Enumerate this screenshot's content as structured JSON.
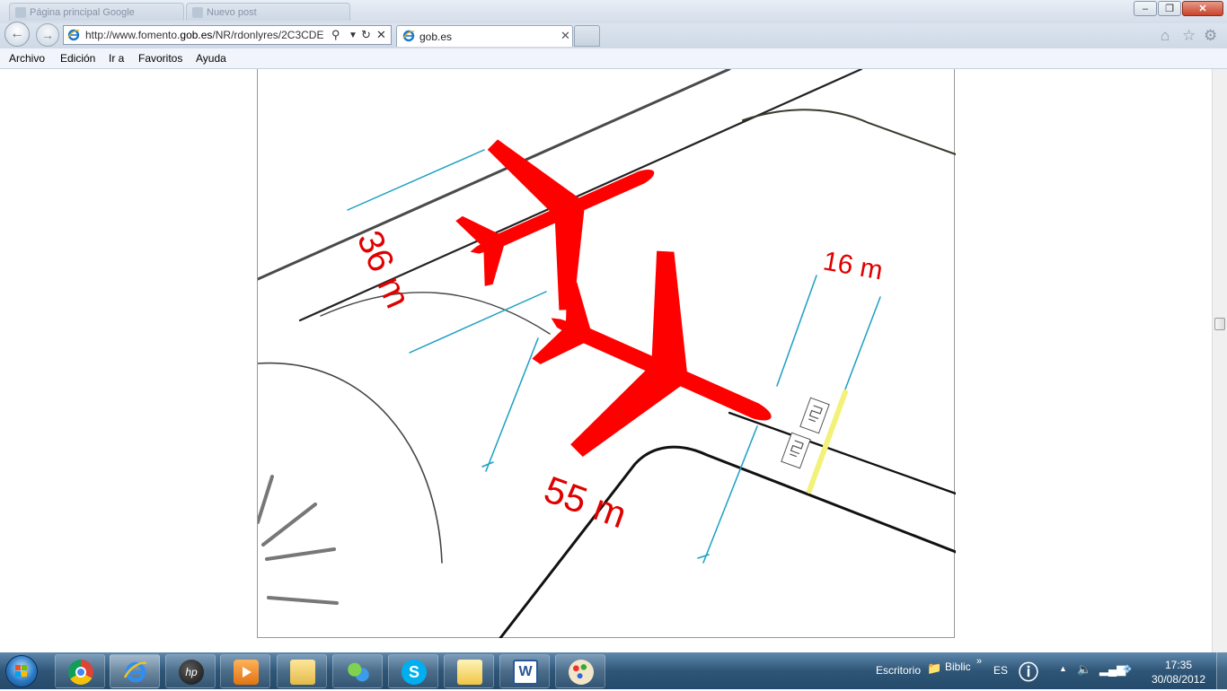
{
  "browser": {
    "url_prefix": "http://www.fomento.",
    "url_domain": "gob.es",
    "url_suffix": "/NR/rdonlyres/2C3CDE",
    "active_tab_title": "gob.es",
    "background_tabs": [
      "Página principal Google",
      "Nuevo post"
    ],
    "window_buttons": [
      "minimize-icon",
      "restore-icon",
      "close-icon"
    ]
  },
  "menu": {
    "items": [
      "Archivo",
      "Edición",
      "Ir a",
      "Favoritos",
      "Ayuda"
    ]
  },
  "diagram": {
    "label_36": "36 m",
    "label_55": "55 m",
    "label_16": "16 m",
    "aircraft_color": "#ff0000",
    "dimension_line_color": "#1a9fc4",
    "hold_line_color": "#f2f27a"
  },
  "taskbar": {
    "apps": [
      "chrome-icon",
      "internet-explorer-icon",
      "hp-icon",
      "media-player-icon",
      "file-explorer-icon",
      "windows-live-messenger-icon",
      "skype-icon",
      "outlook-icon",
      "word-icon",
      "paint-icon"
    ],
    "toolbar_escritorio": "Escritorio",
    "toolbar_biblio": "Biblic",
    "language": "ES",
    "time": "17:35",
    "date": "30/08/2012"
  }
}
